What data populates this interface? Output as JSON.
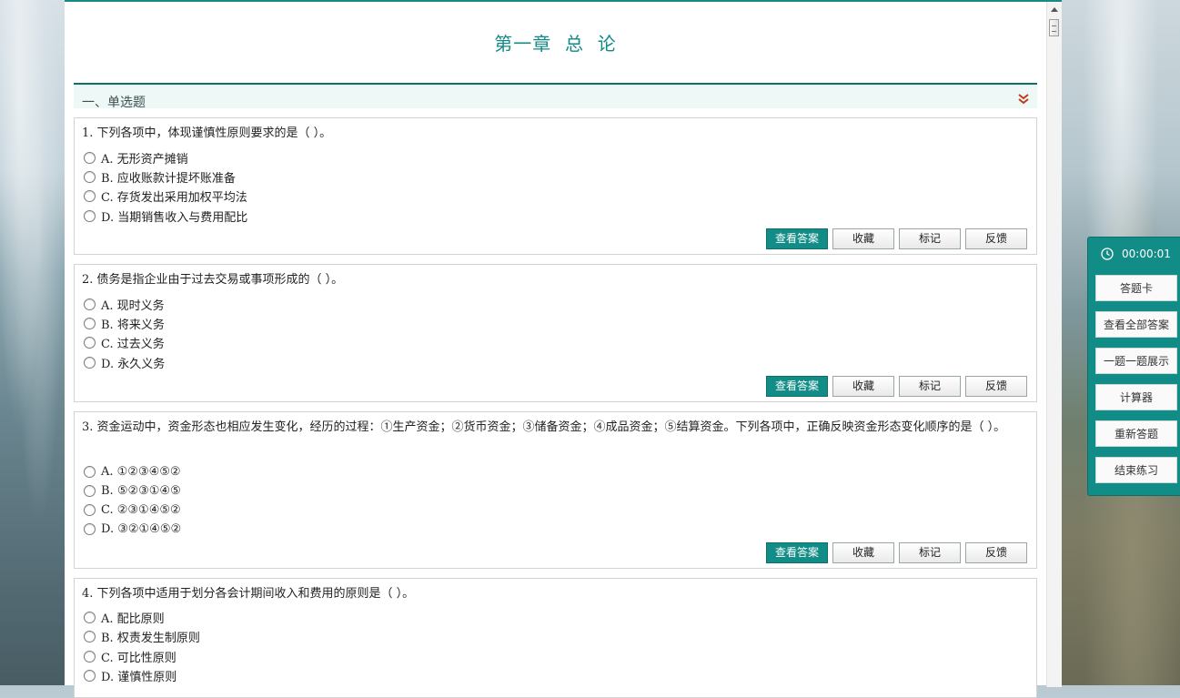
{
  "page": {
    "title": "第一章  总  论"
  },
  "section": {
    "label": "一、单选题"
  },
  "buttons": {
    "view_answer": "查看答案",
    "favorite": "收藏",
    "mark": "标记",
    "feedback": "反馈"
  },
  "questions": [
    {
      "stem": "1. 下列各项中，体现谨慎性原则要求的是（    ）。",
      "options": [
        "A. 无形资产摊销",
        "B. 应收账款计提坏账准备",
        "C. 存货发出采用加权平均法",
        "D. 当期销售收入与费用配比"
      ]
    },
    {
      "stem": "2. 债务是指企业由于过去交易或事项形成的（    ）。",
      "options": [
        "A. 现时义务",
        "B. 将来义务",
        "C. 过去义务",
        "D. 永久义务"
      ]
    },
    {
      "stem": "3. 资金运动中，资金形态也相应发生变化，经历的过程：①生产资金；②货币资金；③储备资金；④成品资金；⑤结算资金。下列各项中，正确反映资金形态变化顺序的是（    ）。",
      "options": [
        "A. ①②③④⑤②",
        "B. ⑤②③①④⑤",
        "C. ②③①④⑤②",
        "D. ③②①④⑤②"
      ]
    },
    {
      "stem": "4. 下列各项中适用于划分各会计期间收入和费用的原则是（    ）。",
      "options": [
        "A. 配比原则",
        "B. 权责发生制原则",
        "C. 可比性原则",
        "D. 谨慎性原则"
      ]
    }
  ],
  "side_panel": {
    "timer": "00:00:01",
    "buttons": [
      "答题卡",
      "查看全部答案",
      "一题一题展示",
      "计算器",
      "重新答题",
      "结束练习"
    ]
  },
  "colors": {
    "accent": "#128c86",
    "title": "#138a86",
    "collapse_icon": "#c0391b"
  }
}
